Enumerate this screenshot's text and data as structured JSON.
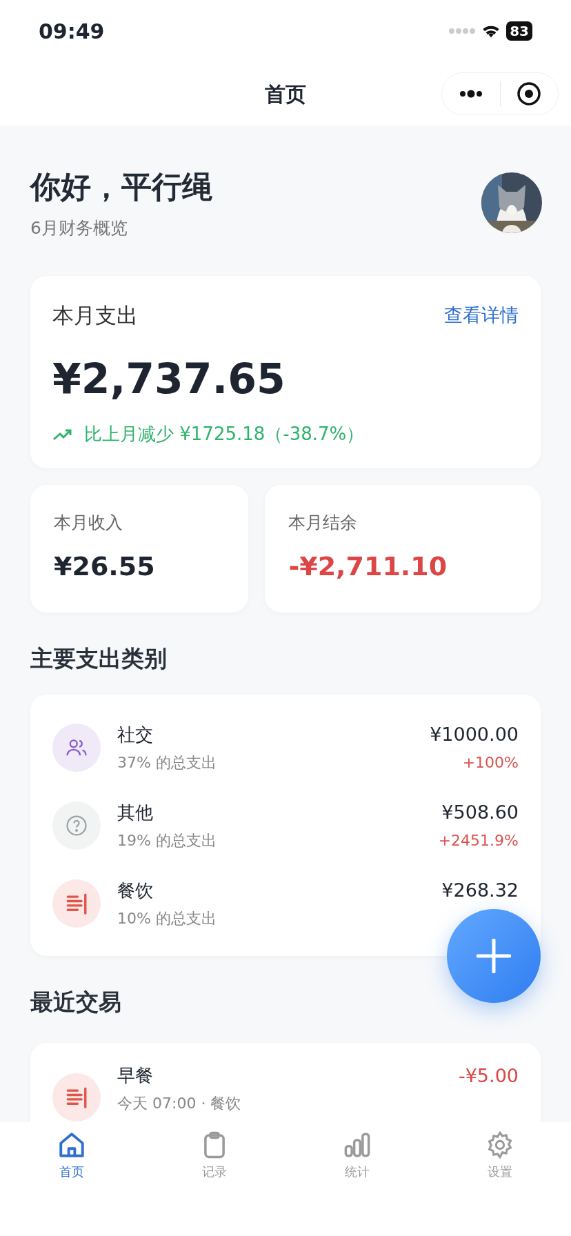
{
  "status_bar": {
    "time": "09:49",
    "battery": "83"
  },
  "nav": {
    "title": "首页"
  },
  "header": {
    "greeting": "你好，平行绳",
    "subtitle": "6月财务概览"
  },
  "expense_card": {
    "label": "本月支出",
    "link": "查看详情",
    "amount": "¥2,737.65",
    "trend": "比上月减少 ¥1725.18（-38.7%）"
  },
  "summary": [
    {
      "label": "本月收入",
      "amount": "¥26.55",
      "negative": false
    },
    {
      "label": "本月结余",
      "amount": "-¥2,711.10",
      "negative": true
    }
  ],
  "categories_title": "主要支出类别",
  "categories": [
    {
      "kind": "people",
      "color": "#8a5cc8",
      "name": "社交",
      "share": "37% 的总支出",
      "amount": "¥1000.00",
      "change": "+100%"
    },
    {
      "kind": "question",
      "color": "#9aa3a8",
      "name": "其他",
      "share": "19% 的总支出",
      "amount": "¥508.60",
      "change": "+2451.9%"
    },
    {
      "kind": "food",
      "color": "#e0544a",
      "name": "餐饮",
      "share": "10% 的总支出",
      "amount": "¥268.32"
    }
  ],
  "recent_title": "最近交易",
  "transactions": [
    {
      "kind": "food",
      "color": "#e0544a",
      "name": "早餐",
      "detail": "今天 07:00 · 餐饮",
      "amount": "-¥5.00"
    }
  ],
  "tabs": [
    {
      "kind": "home",
      "label": "首页",
      "selected": true
    },
    {
      "kind": "clipboard",
      "label": "记录",
      "selected": false
    },
    {
      "kind": "chart",
      "label": "统计",
      "selected": false
    },
    {
      "kind": "gear",
      "label": "设置",
      "selected": false
    }
  ]
}
